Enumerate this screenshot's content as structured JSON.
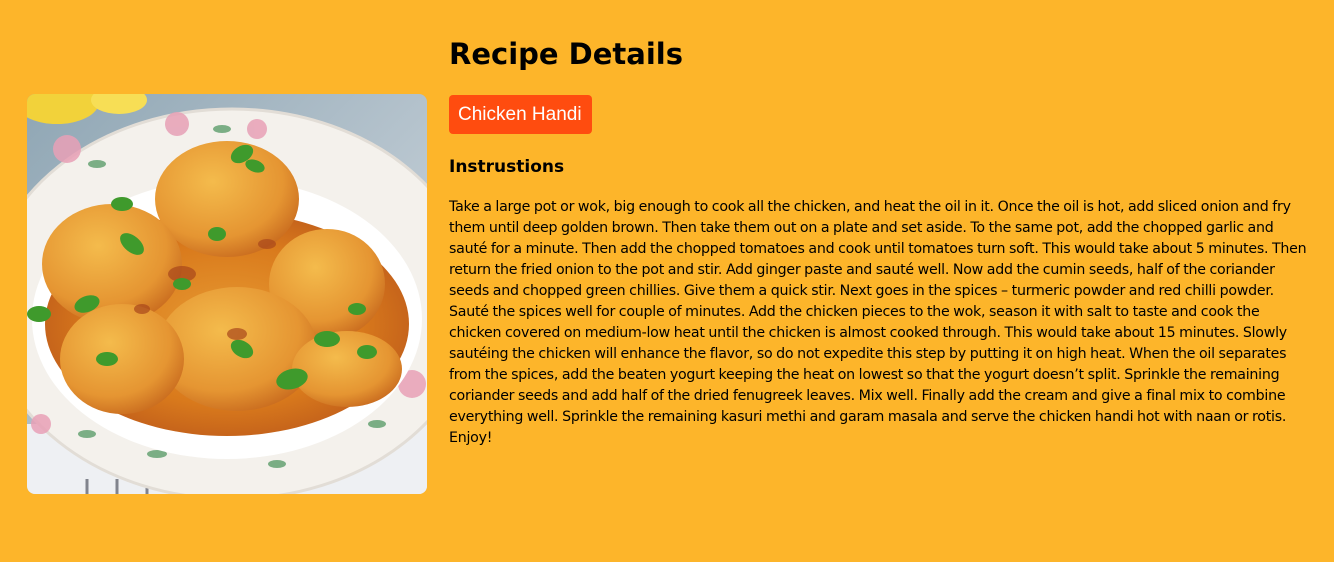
{
  "page": {
    "title": "Recipe Details"
  },
  "recipe": {
    "name": "Chicken Handi",
    "instructions_heading": "Instrustions",
    "instructions": "Take a large pot or wok, big enough to cook all the chicken, and heat the oil in it. Once the oil is hot, add sliced onion and fry them until deep golden brown. Then take them out on a plate and set aside. To the same pot, add the chopped garlic and sauté for a minute. Then add the chopped tomatoes and cook until tomatoes turn soft. This would take about 5 minutes. Then return the fried onion to the pot and stir. Add ginger paste and sauté well. Now add the cumin seeds, half of the coriander seeds and chopped green chillies. Give them a quick stir. Next goes in the spices – turmeric powder and red chilli powder. Sauté the spices well for couple of minutes. Add the chicken pieces to the wok, season it with salt to taste and cook the chicken covered on medium-low heat until the chicken is almost cooked through. This would take about 15 minutes. Slowly sautéing the chicken will enhance the flavor, so do not expedite this step by putting it on high heat. When the oil separates from the spices, add the beaten yogurt keeping the heat on lowest so that the yogurt doesn’t split. Sprinkle the remaining coriander seeds and add half of the dried fenugreek leaves. Mix well. Finally add the cream and give a final mix to combine everything well. Sprinkle the remaining kasuri methi and garam masala and serve the chicken handi hot with naan or rotis. Enjoy!"
  },
  "colors": {
    "background": "#fdb52a",
    "badge": "#ff4c0f",
    "badge_text": "#ffffff"
  }
}
